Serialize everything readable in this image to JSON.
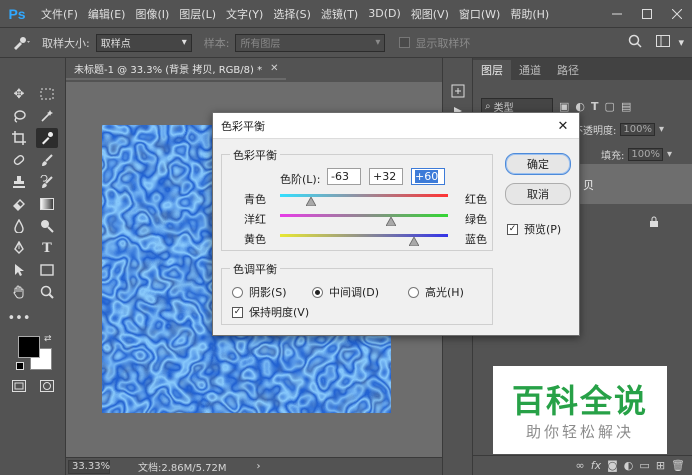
{
  "app": {
    "logo": "Ps",
    "menu": [
      "文件(F)",
      "编辑(E)",
      "图像(I)",
      "图层(L)",
      "文字(Y)",
      "选择(S)",
      "滤镜(T)",
      "3D(D)",
      "视图(V)",
      "窗口(W)",
      "帮助(H)"
    ]
  },
  "options": {
    "sample_size_label": "取样大小:",
    "sample_size_value": "取样点",
    "sample_label": "样本:",
    "sample_value": "所有图层",
    "show_ring_label": "显示取样环"
  },
  "document": {
    "tab_title": "未标题-1 @ 33.3% (背景 拷贝, RGB/8) *",
    "zoom": "33.33%",
    "doc_info": "文档:2.86M/5.72M"
  },
  "layers_panel": {
    "tabs": [
      "图层",
      "通道",
      "路径"
    ],
    "kind_filter": "类型",
    "opacity_label": "不透明度:",
    "opacity_value": "100%",
    "fill_label": "填充:",
    "fill_value": "100%",
    "layer_name_partial": "贝"
  },
  "dialog": {
    "title": "色彩平衡",
    "color_balance_group": "色彩平衡",
    "levels_label": "色阶(L):",
    "levels": [
      "-63",
      "+32",
      "+60"
    ],
    "sliders": [
      {
        "left": "青色",
        "right": "红色",
        "value": -63
      },
      {
        "left": "洋红",
        "right": "绿色",
        "value": 32
      },
      {
        "left": "黄色",
        "right": "蓝色",
        "value": 60
      }
    ],
    "tone_group": "色调平衡",
    "tones": [
      "阴影(S)",
      "中间调(D)",
      "高光(H)"
    ],
    "tone_selected": 1,
    "preserve_luminosity": "保持明度(V)",
    "ok": "确定",
    "cancel": "取消",
    "preview": "预览(P)"
  },
  "watermark": {
    "main": "百科全说",
    "sub": "助你轻松解决"
  }
}
